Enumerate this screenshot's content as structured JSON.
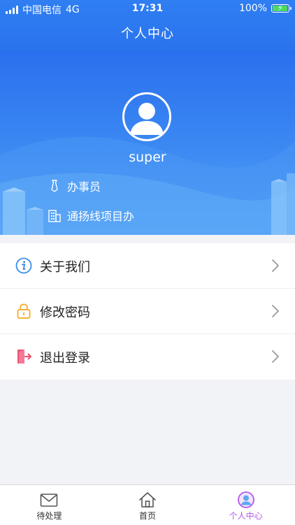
{
  "status_bar": {
    "carrier": "中国电信",
    "network": "4G",
    "time": "17:31",
    "battery_percent": "100%",
    "battery_level": 1.0
  },
  "header": {
    "title": "个人中心"
  },
  "profile": {
    "username": "super",
    "role": "办事员",
    "department": "通扬线项目办",
    "avatar_icon": "user-avatar-icon"
  },
  "menu": {
    "items": [
      {
        "label": "关于我们",
        "icon": "info-icon",
        "color": "#3a8ee6"
      },
      {
        "label": "修改密码",
        "icon": "lock-icon",
        "color": "#f5b233"
      },
      {
        "label": "退出登录",
        "icon": "logout-icon",
        "color": "#ef4f74"
      }
    ]
  },
  "tabbar": {
    "tabs": [
      {
        "label": "待处理",
        "icon": "mail-icon",
        "active": false
      },
      {
        "label": "首页",
        "icon": "home-icon",
        "active": false
      },
      {
        "label": "个人中心",
        "icon": "profile-icon",
        "active": true
      }
    ],
    "active_color": "#b259e8"
  },
  "colors": {
    "header_blue": "#2f7ef2",
    "hero_blue": "#3c8af3",
    "background": "#f2f3f7"
  }
}
